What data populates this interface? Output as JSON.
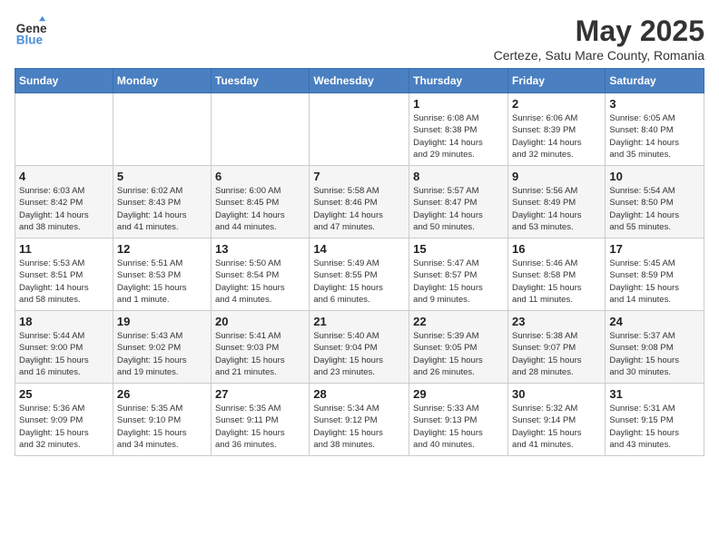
{
  "header": {
    "logo_line1": "General",
    "logo_line2": "Blue",
    "month": "May 2025",
    "location": "Certeze, Satu Mare County, Romania"
  },
  "weekdays": [
    "Sunday",
    "Monday",
    "Tuesday",
    "Wednesday",
    "Thursday",
    "Friday",
    "Saturday"
  ],
  "weeks": [
    [
      {
        "day": "",
        "content": ""
      },
      {
        "day": "",
        "content": ""
      },
      {
        "day": "",
        "content": ""
      },
      {
        "day": "",
        "content": ""
      },
      {
        "day": "1",
        "content": "Sunrise: 6:08 AM\nSunset: 8:38 PM\nDaylight: 14 hours\nand 29 minutes."
      },
      {
        "day": "2",
        "content": "Sunrise: 6:06 AM\nSunset: 8:39 PM\nDaylight: 14 hours\nand 32 minutes."
      },
      {
        "day": "3",
        "content": "Sunrise: 6:05 AM\nSunset: 8:40 PM\nDaylight: 14 hours\nand 35 minutes."
      }
    ],
    [
      {
        "day": "4",
        "content": "Sunrise: 6:03 AM\nSunset: 8:42 PM\nDaylight: 14 hours\nand 38 minutes."
      },
      {
        "day": "5",
        "content": "Sunrise: 6:02 AM\nSunset: 8:43 PM\nDaylight: 14 hours\nand 41 minutes."
      },
      {
        "day": "6",
        "content": "Sunrise: 6:00 AM\nSunset: 8:45 PM\nDaylight: 14 hours\nand 44 minutes."
      },
      {
        "day": "7",
        "content": "Sunrise: 5:58 AM\nSunset: 8:46 PM\nDaylight: 14 hours\nand 47 minutes."
      },
      {
        "day": "8",
        "content": "Sunrise: 5:57 AM\nSunset: 8:47 PM\nDaylight: 14 hours\nand 50 minutes."
      },
      {
        "day": "9",
        "content": "Sunrise: 5:56 AM\nSunset: 8:49 PM\nDaylight: 14 hours\nand 53 minutes."
      },
      {
        "day": "10",
        "content": "Sunrise: 5:54 AM\nSunset: 8:50 PM\nDaylight: 14 hours\nand 55 minutes."
      }
    ],
    [
      {
        "day": "11",
        "content": "Sunrise: 5:53 AM\nSunset: 8:51 PM\nDaylight: 14 hours\nand 58 minutes."
      },
      {
        "day": "12",
        "content": "Sunrise: 5:51 AM\nSunset: 8:53 PM\nDaylight: 15 hours\nand 1 minute."
      },
      {
        "day": "13",
        "content": "Sunrise: 5:50 AM\nSunset: 8:54 PM\nDaylight: 15 hours\nand 4 minutes."
      },
      {
        "day": "14",
        "content": "Sunrise: 5:49 AM\nSunset: 8:55 PM\nDaylight: 15 hours\nand 6 minutes."
      },
      {
        "day": "15",
        "content": "Sunrise: 5:47 AM\nSunset: 8:57 PM\nDaylight: 15 hours\nand 9 minutes."
      },
      {
        "day": "16",
        "content": "Sunrise: 5:46 AM\nSunset: 8:58 PM\nDaylight: 15 hours\nand 11 minutes."
      },
      {
        "day": "17",
        "content": "Sunrise: 5:45 AM\nSunset: 8:59 PM\nDaylight: 15 hours\nand 14 minutes."
      }
    ],
    [
      {
        "day": "18",
        "content": "Sunrise: 5:44 AM\nSunset: 9:00 PM\nDaylight: 15 hours\nand 16 minutes."
      },
      {
        "day": "19",
        "content": "Sunrise: 5:43 AM\nSunset: 9:02 PM\nDaylight: 15 hours\nand 19 minutes."
      },
      {
        "day": "20",
        "content": "Sunrise: 5:41 AM\nSunset: 9:03 PM\nDaylight: 15 hours\nand 21 minutes."
      },
      {
        "day": "21",
        "content": "Sunrise: 5:40 AM\nSunset: 9:04 PM\nDaylight: 15 hours\nand 23 minutes."
      },
      {
        "day": "22",
        "content": "Sunrise: 5:39 AM\nSunset: 9:05 PM\nDaylight: 15 hours\nand 26 minutes."
      },
      {
        "day": "23",
        "content": "Sunrise: 5:38 AM\nSunset: 9:07 PM\nDaylight: 15 hours\nand 28 minutes."
      },
      {
        "day": "24",
        "content": "Sunrise: 5:37 AM\nSunset: 9:08 PM\nDaylight: 15 hours\nand 30 minutes."
      }
    ],
    [
      {
        "day": "25",
        "content": "Sunrise: 5:36 AM\nSunset: 9:09 PM\nDaylight: 15 hours\nand 32 minutes."
      },
      {
        "day": "26",
        "content": "Sunrise: 5:35 AM\nSunset: 9:10 PM\nDaylight: 15 hours\nand 34 minutes."
      },
      {
        "day": "27",
        "content": "Sunrise: 5:35 AM\nSunset: 9:11 PM\nDaylight: 15 hours\nand 36 minutes."
      },
      {
        "day": "28",
        "content": "Sunrise: 5:34 AM\nSunset: 9:12 PM\nDaylight: 15 hours\nand 38 minutes."
      },
      {
        "day": "29",
        "content": "Sunrise: 5:33 AM\nSunset: 9:13 PM\nDaylight: 15 hours\nand 40 minutes."
      },
      {
        "day": "30",
        "content": "Sunrise: 5:32 AM\nSunset: 9:14 PM\nDaylight: 15 hours\nand 41 minutes."
      },
      {
        "day": "31",
        "content": "Sunrise: 5:31 AM\nSunset: 9:15 PM\nDaylight: 15 hours\nand 43 minutes."
      }
    ]
  ]
}
